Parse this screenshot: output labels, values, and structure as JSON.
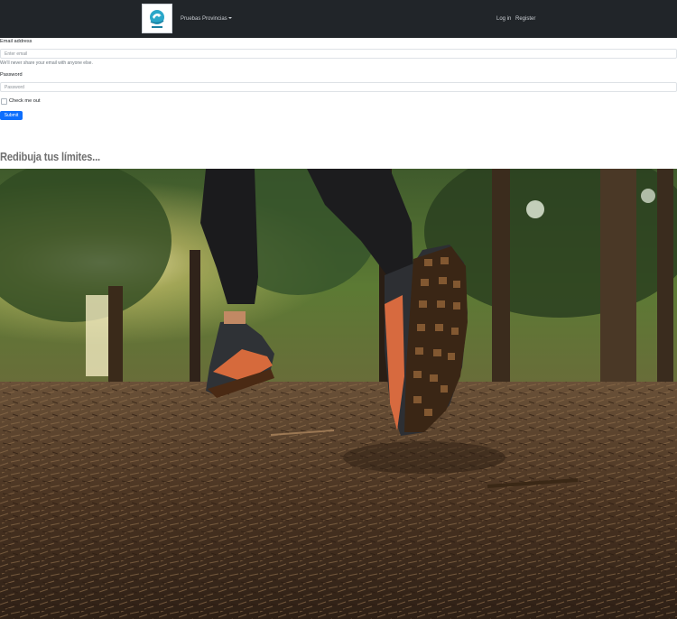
{
  "navbar": {
    "logo_icon": "club-logo-icon",
    "links": {
      "pruebas": "Pruebas",
      "provincias": "Provincias",
      "login": "Log in",
      "register": "Register"
    }
  },
  "form": {
    "email_label": "Email address",
    "email_placeholder": "Enter email",
    "email_help": "We'll never share your email with anyone else.",
    "password_label": "Password",
    "password_placeholder": "Password",
    "checkbox_label": "Check me out",
    "submit_label": "Submit"
  },
  "headline": "Redibuja tus límites...",
  "hero": {
    "subject": "runner-on-forest-trail-image"
  },
  "colors": {
    "navbar_bg": "#212529",
    "primary_button": "#0d6efd",
    "headline": "#707070"
  }
}
